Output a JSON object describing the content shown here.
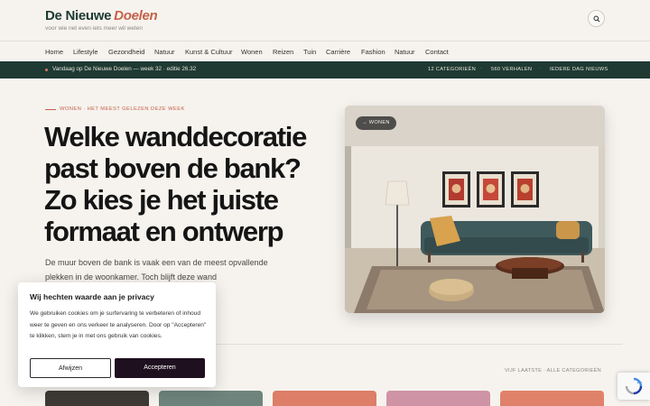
{
  "header": {
    "logo_main": "De Nieuwe",
    "logo_accent": "Doelen",
    "tagline": "voor wie net even iets meer wil weten",
    "search_icon": "search-icon"
  },
  "nav": {
    "items": [
      "Home",
      "Lifestyle",
      "Gezondheid",
      "Natuur",
      "Kunst & Cultuur",
      "Wonen",
      "Reizen",
      "Tuin",
      "Carrière",
      "Fashion",
      "Natuur",
      "Contact"
    ]
  },
  "ticker": {
    "text": "Vandaag op De Nieuwe Doelen — week 32 · editie 26.32",
    "stats": [
      "12 CATEGORIEËN",
      "560 VERHALEN",
      "IEDERE DAG NIEUWS"
    ]
  },
  "hero": {
    "kicker": "WONEN · HET MEEST GELEZEN DEZE WEEK",
    "title": "Welke wanddecoratie past boven de bank? Zo kies je het juiste formaat en ontwerp",
    "lead": "De muur boven de bank is vaak een van de meest opvallende plekken in de woonkamer. Toch blijft deze wand",
    "badge": "→ WONEN"
  },
  "latest": {
    "label": "VIJF LAATSTE · ALLE CATEGORIEËN"
  },
  "cookie": {
    "title": "Wij hechten waarde aan je privacy",
    "body": "We gebruiken cookies om je surfervaring te verbeteren of inhoud weer te geven en ons verkeer te analyseren. Door op \"Accepteren\" te klikken, stem je in met ons gebruik van cookies.",
    "decline": "Afwijzen",
    "accept": "Accepteren"
  },
  "colors": {
    "brand": "#1e3a33",
    "accent": "#c4614a",
    "background": "#f6f3ee"
  }
}
